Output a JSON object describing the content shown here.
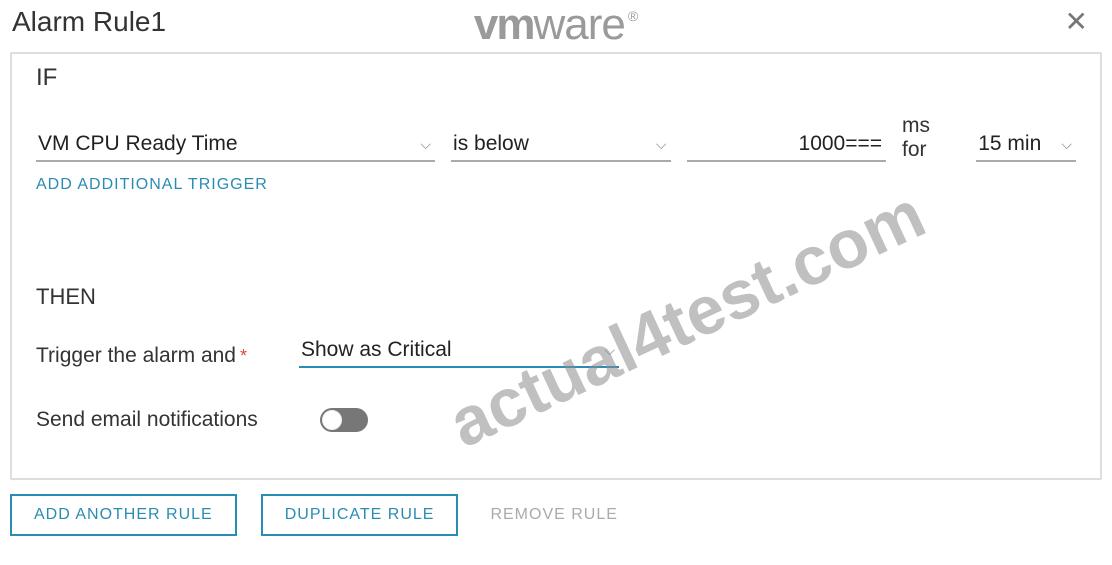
{
  "title": "Alarm Rule1",
  "logo": {
    "vm": "vm",
    "ware": "ware",
    "r": "®"
  },
  "close_glyph": "✕",
  "panel": {
    "if_label": "IF",
    "metric": "VM CPU Ready Time",
    "condition": "is below",
    "value": "1000===",
    "unit": "ms for",
    "duration": "15 min",
    "add_trigger": "ADD ADDITIONAL TRIGGER",
    "then_label": "THEN",
    "trigger_label": "Trigger the alarm and",
    "severity": "Show as Critical",
    "notif_label": "Send email notifications"
  },
  "footer": {
    "add_rule": "ADD ANOTHER RULE",
    "duplicate": "DUPLICATE RULE",
    "remove": "REMOVE RULE"
  },
  "watermark": "actual4test.com",
  "caret": "⌵"
}
